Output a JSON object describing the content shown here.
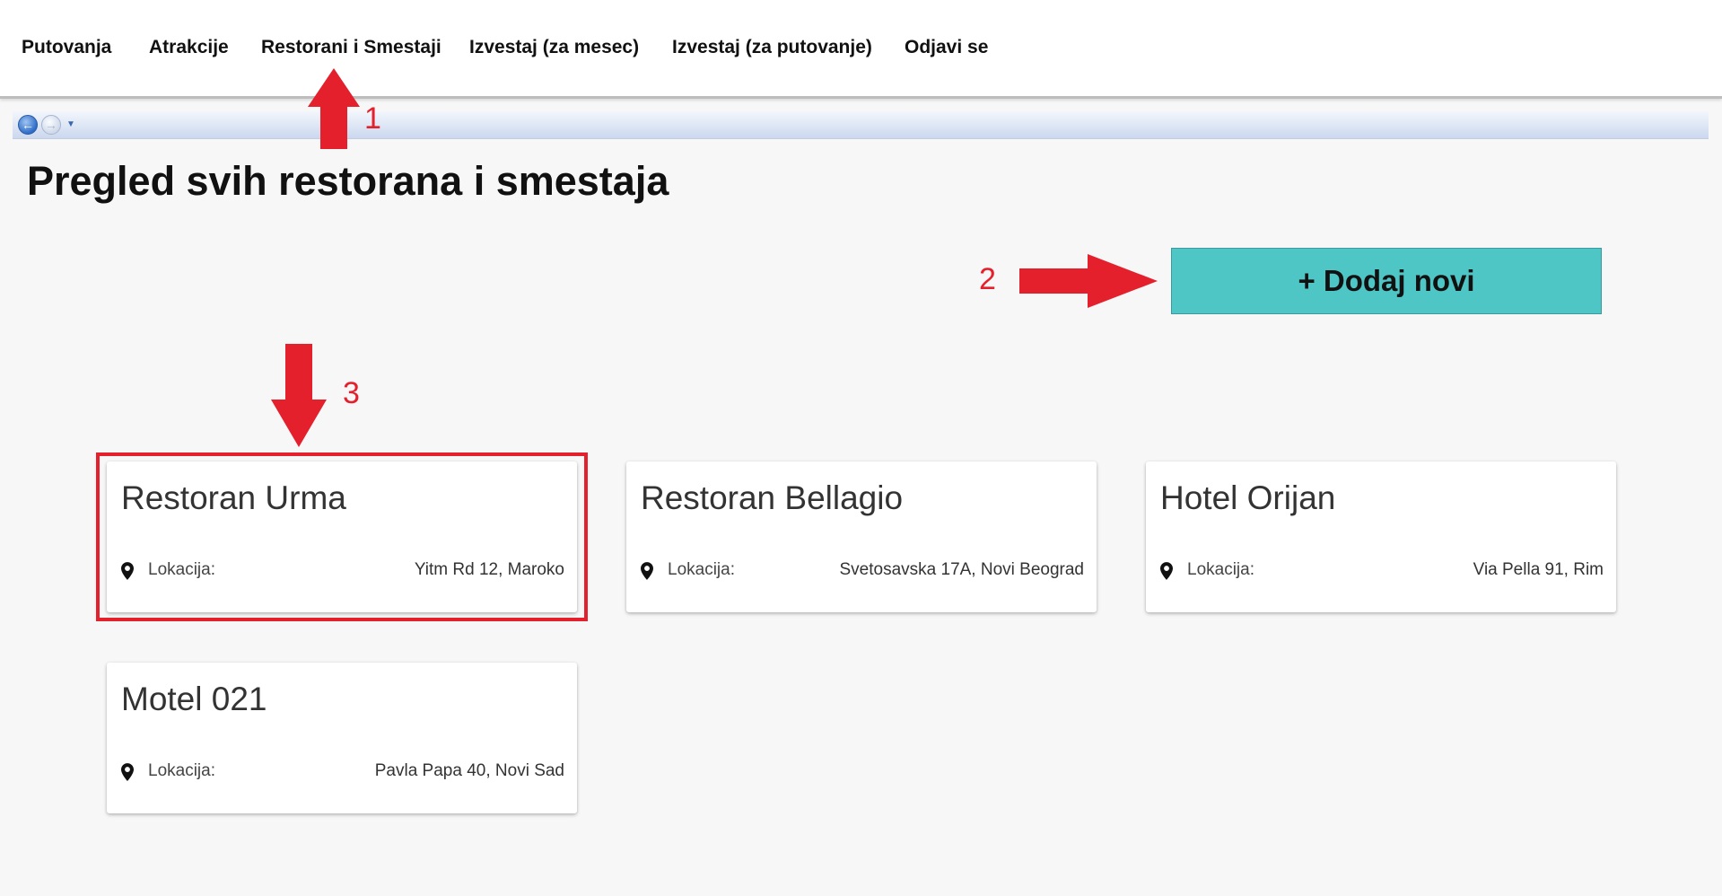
{
  "nav": {
    "items": [
      {
        "label": "Putovanja"
      },
      {
        "label": "Atrakcije"
      },
      {
        "label": "Restorani i Smestaji"
      },
      {
        "label": "Izvestaj (za mesec)"
      },
      {
        "label": "Izvestaj (za putovanje)"
      },
      {
        "label": "Odjavi se"
      }
    ]
  },
  "page": {
    "title": "Pregled svih restorana i smestaja",
    "add_button_label": "+ Dodaj novi"
  },
  "location_label": "Lokacija:",
  "cards": [
    {
      "name": "Restoran Urma",
      "location": "Yitm Rd 12, Maroko"
    },
    {
      "name": "Restoran Bellagio",
      "location": "Svetosavska 17A, Novi Beograd"
    },
    {
      "name": "Hotel Orijan",
      "location": "Via Pella 91, Rim"
    },
    {
      "name": "Motel 021",
      "location": "Pavla Papa 40, Novi Sad"
    }
  ],
  "annotations": {
    "step1": "1",
    "step2": "2",
    "step3": "3",
    "color": "#e3202c"
  },
  "colors": {
    "accent_button": "#4ec6c6",
    "background": "#f7f7f7"
  },
  "icons": {
    "location": "location-pin-icon",
    "back": "back-arrow-icon",
    "forward": "forward-arrow-icon"
  }
}
